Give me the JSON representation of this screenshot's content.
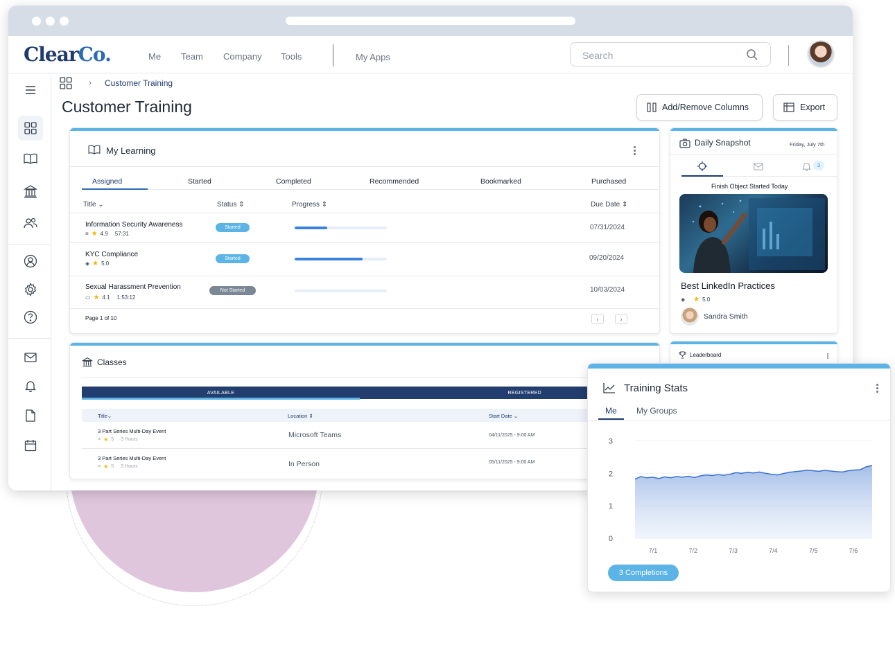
{
  "brand": {
    "logo_main": "Clear",
    "logo_accent": "Co."
  },
  "topnav": {
    "links": [
      "Me",
      "Team",
      "Company",
      "Tools"
    ],
    "my_apps": "My Apps",
    "search_placeholder": "Search"
  },
  "breadcrumb": {
    "current": "Customer Training"
  },
  "page": {
    "title": "Customer Training"
  },
  "toolbar": {
    "columns_label": "Add/Remove Columns",
    "export_label": "Export"
  },
  "my_learning": {
    "title": "My Learning",
    "tabs": [
      "Assigned",
      "Started",
      "Completed",
      "Recommended",
      "Bookmarked",
      "Purchased"
    ],
    "active_tab": "Assigned",
    "columns": {
      "title": "Title",
      "status": "Status",
      "progress": "Progress",
      "due": "Due Date"
    },
    "rows": [
      {
        "title": "Information Security Awareness",
        "rating": "4.9",
        "duration": "57:31",
        "status": "Started",
        "progress": 0.35,
        "due": "07/31/2024"
      },
      {
        "title": "KYC Compliance",
        "rating": "5.0",
        "duration": "",
        "status": "Started",
        "progress": 0.74,
        "due": "09/20/2024"
      },
      {
        "title": "Sexual Harassment Prevention",
        "rating": "4.1",
        "duration": "1:53:12",
        "status": "Not Started",
        "progress": 0,
        "due": "10/03/2024"
      }
    ],
    "pagination": "Page 1 of 10"
  },
  "classes": {
    "title": "Classes",
    "tab_available": "AVAILABLE",
    "tab_registered": "REGISTERED",
    "columns": {
      "title": "Title",
      "location": "Location",
      "start": "Start Date"
    },
    "rows": [
      {
        "title": "3 Part Series Multi-Day Event",
        "rating": "5",
        "duration": "3 Hours",
        "location": "Microsoft Teams",
        "start": "04/11/2025 - 9:00 AM"
      },
      {
        "title": "3 Part Series Multi-Day Event",
        "rating": "5",
        "duration": "3 Hours",
        "location": "In Person",
        "start": "05/11/2025 - 9:00 AM"
      }
    ]
  },
  "snapshot": {
    "title": "Daily Snapshot",
    "date": "Friday, July 7th",
    "notif_count": "3",
    "caption": "Finish Object Started Today",
    "course": "Best LinkedIn Practices",
    "rating": "5.0",
    "author": "Sandra Smith"
  },
  "leaderboard": {
    "title": "Leaderboard"
  },
  "training_stats": {
    "title": "Training Stats",
    "tabs": [
      "Me",
      "My Groups"
    ],
    "active_tab": "Me",
    "completions_label": "3 Completions"
  },
  "chart_data": {
    "type": "area",
    "x": [
      "7/1",
      "7/2",
      "7/3",
      "7/4",
      "7/5",
      "7/6"
    ],
    "y_ticks": [
      0,
      1,
      2,
      3
    ],
    "ylim": [
      0,
      3.2
    ],
    "series": [
      {
        "values": [
          1.82,
          1.9,
          1.86,
          1.88,
          1.84,
          1.89,
          1.86,
          1.9,
          1.88,
          1.91,
          1.87,
          1.92,
          1.95,
          1.93,
          1.96,
          1.94,
          1.97,
          2.02,
          2.0,
          2.03,
          2.01,
          2.04,
          2.0,
          1.97,
          1.95,
          1.99,
          2.03,
          2.05,
          2.07,
          2.1,
          2.08,
          2.06,
          2.09,
          2.07,
          2.05,
          2.04,
          2.08,
          2.1,
          2.11,
          2.2,
          2.24
        ]
      }
    ],
    "grid": true,
    "color": "#3b6fd1"
  },
  "colors": {
    "accent": "#5bb3e6",
    "navy": "#1e3a6e",
    "progress": "#3b82e0",
    "status_started": "#5bb3e6",
    "status_not_started": "#7b8794"
  },
  "icons": [
    "menu-icon",
    "dashboard-icon",
    "book-icon",
    "bank-icon",
    "users-icon",
    "profile-icon",
    "gear-icon",
    "help-icon",
    "mail-icon",
    "bell-icon",
    "file-icon",
    "calendar-icon",
    "search-icon",
    "camera-icon",
    "trophy-icon",
    "chart-icon"
  ]
}
